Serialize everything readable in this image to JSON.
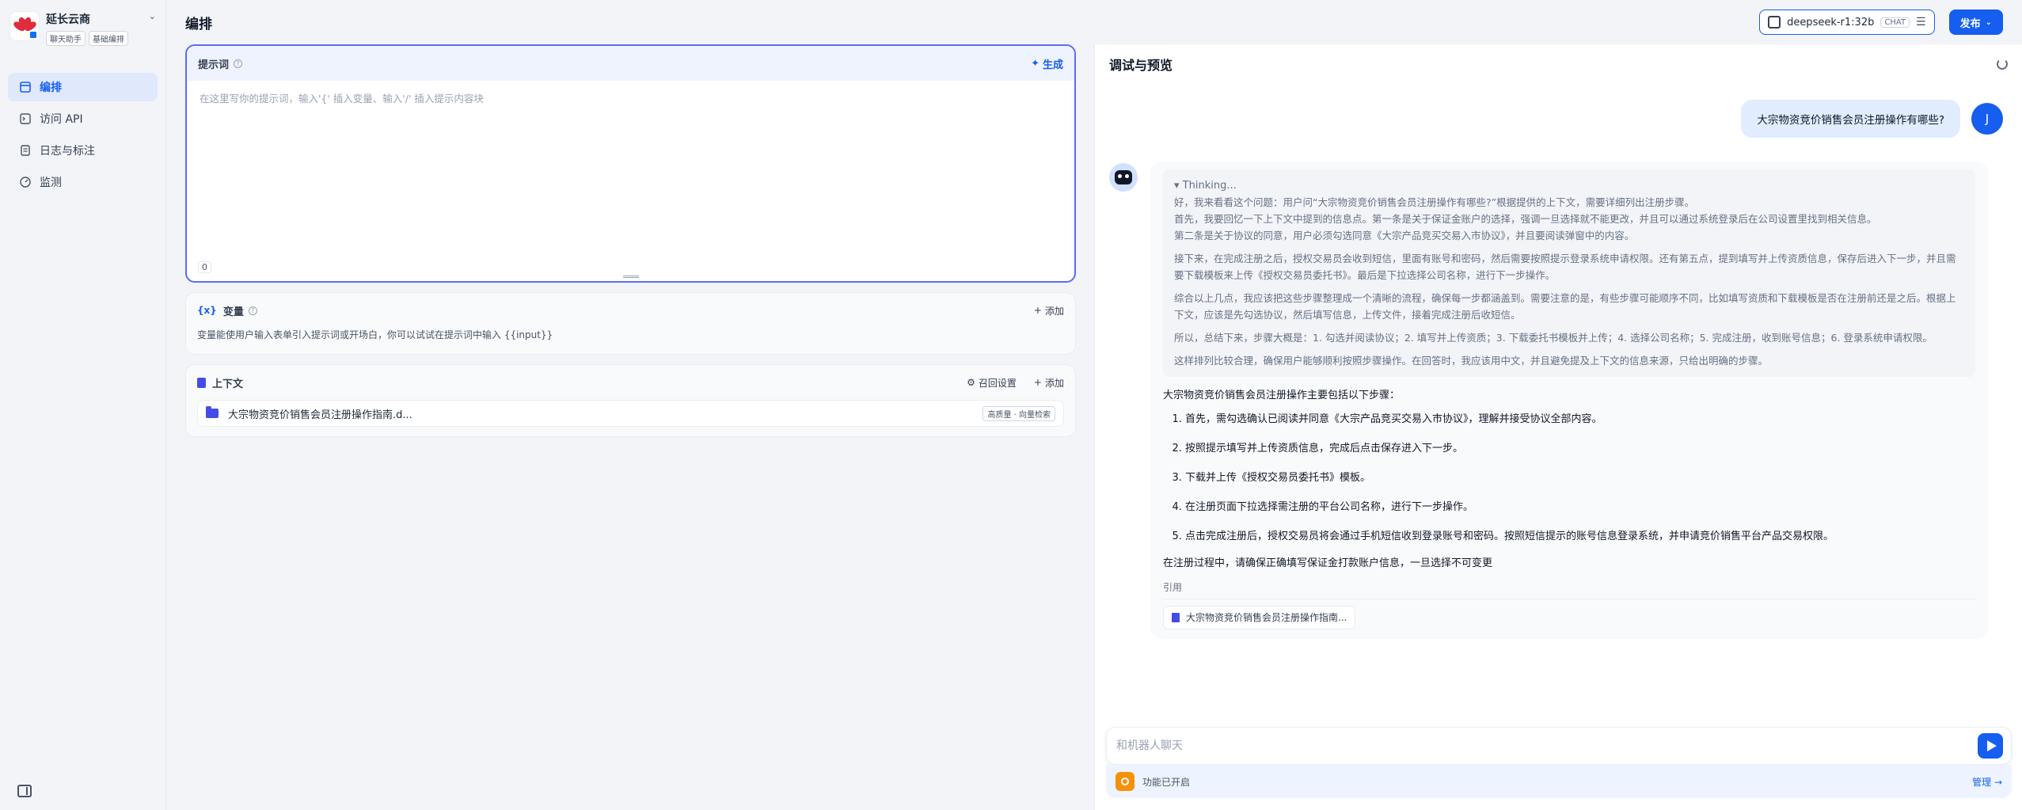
{
  "sidebar": {
    "app_name": "延长云商",
    "app_tags": [
      "聊天助手",
      "基础编排"
    ],
    "items": [
      {
        "label": "编排",
        "icon": "layout-icon",
        "active": true
      },
      {
        "label": "访问 API",
        "icon": "terminal-icon",
        "active": false
      },
      {
        "label": "日志与标注",
        "icon": "file-text-icon",
        "active": false
      },
      {
        "label": "监测",
        "icon": "dashboard-icon",
        "active": false
      }
    ]
  },
  "header": {
    "title": "编排",
    "model_name": "deepseek-r1:32b",
    "model_mode": "CHAT",
    "publish_label": "发布"
  },
  "prompt": {
    "title": "提示词",
    "generate_label": "生成",
    "placeholder": "在这里写你的提示词，输入'{' 插入变量、输入'/' 插入提示内容块",
    "count": "0"
  },
  "variables": {
    "title": "变量",
    "add_label": "添加",
    "description": "变量能使用户输入表单引入提示词或开场白，你可以试试在提示词中输入 {{input}}"
  },
  "context": {
    "title": "上下文",
    "recall_label": "召回设置",
    "add_label": "添加",
    "items": [
      {
        "name": "大宗物资竞价销售会员注册操作指南.d...",
        "tag": "高质量 · 向量检索"
      }
    ]
  },
  "preview": {
    "title": "调试与预览",
    "user_avatar": "J",
    "user_message": "大宗物资竞价销售会员注册操作有哪些?",
    "thinking_label": "▾ Thinking...",
    "thinking": [
      "好，我来看看这个问题：用户问“大宗物资竞价销售会员注册操作有哪些?”根据提供的上下文，需要详细列出注册步骤。\n首先，我要回忆一下上下文中提到的信息点。第一条是关于保证金账户的选择，强调一旦选择就不能更改，并且可以通过系统登录后在公司设置里找到相关信息。\n第二条是关于协议的同意，用户必须勾选同意《大宗产品竞买交易入市协议》，并且要阅读弹窗中的内容。",
      "接下来，在完成注册之后，授权交易员会收到短信，里面有账号和密码，然后需要按照提示登录系统申请权限。还有第五点，提到填写并上传资质信息，保存后进入下一步，并且需要下载模板来上传《授权交易员委托书》。最后是下拉选择公司名称，进行下一步操作。",
      "综合以上几点，我应该把这些步骤整理成一个清晰的流程，确保每一步都涵盖到。需要注意的是，有些步骤可能顺序不同，比如填写资质和下载模板是否在注册前还是之后。根据上下文，应该是先勾选协议，然后填写信息，上传文件，接着完成注册后收短信。",
      "所以，总结下来，步骤大概是：1. 勾选并阅读协议；2. 填写并上传资质；3. 下载委托书模板并上传；4. 选择公司名称；5. 完成注册，收到账号信息；6. 登录系统申请权限。",
      "这样排列比较合理，确保用户能够顺利按照步骤操作。在回答时，我应该用中文，并且避免提及上下文的信息来源，只给出明确的步骤。"
    ],
    "answer_intro": "大宗物资竞价销售会员注册操作主要包括以下步骤：",
    "answer_steps": [
      "首先，需勾选确认已阅读并同意《大宗产品竞买交易入市协议》，理解并接受协议全部内容。",
      "按照提示填写并上传资质信息，完成后点击保存进入下一步。",
      "下载并上传《授权交易员委托书》模板。",
      "在注册页面下拉选择需注册的平台公司名称，进行下一步操作。",
      "点击完成注册后，授权交易员将会通过手机短信收到登录账号和密码。按照短信提示的账号信息登录系统，并申请竞价销售平台产品交易权限。"
    ],
    "answer_tail": "在注册过程中，请确保正确填写保证金打款账户信息，一旦选择不可变更",
    "citation_label": "引用",
    "citation_item": "大宗物资竞价销售会员注册操作指南...",
    "input_placeholder": "和机器人聊天",
    "feature_text": "功能已开启",
    "manage_label": "管理 →"
  }
}
